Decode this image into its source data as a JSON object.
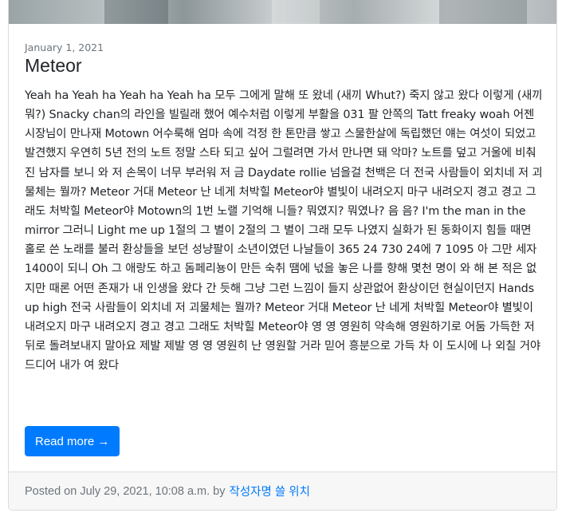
{
  "post": {
    "date": "January 1, 2021",
    "title": "Meteor",
    "body": "Yeah ha Yeah ha Yeah ha Yeah ha 모두 그에게 말해 또 왔네 (새끼 Whut?) 죽지 않고 왔다 이렇게 (새끼 뭐?) Snacky chan의 라인을 빌릴래 했어 예수처럼 이렇게 부활을 031 팔 안쪽의 Tatt freaky woah 어젠 시장님이 만나재 Motown 어수룩해 엄마 속에 걱정 한 톤만큼 쌓고 스물한살에 독립했던 얘는 여섯이 되었고 발견했지 우연히 5년 전의 노트 정말 스타 되고 싶어 그럴려면 가서 만나면 돼 악마? 노트를 덮고 거울에 비춰진 남자를 보니 와 저 손목이 너무 부러워 저 금 Daydate rollie 넘을걸 천백은 더 전국 사람들이 외치네 저 괴물체는 뭘까? Meteor 거대 Meteor 난 네게 처박힐 Meteor야 별빛이 내려오지 마구 내려오지 경고 경고 그래도 처박힐 Meteor야 Motown의 1번 노랠 기억해 니들? 뭐였지? 뭐였나? 음 음? I'm the man in the mirror 그러니 Light me up 1절의 그 별이 2절의 그 별이 그래 모두 나였지 실화가 된 동화이지 힘들 때면 홀로 쓴 노래를 불러 환상들을 보던 성냥팔이 소년이였던 나날들이 365 24 730 24에 7 1095 아 그만 세자 1400이 되니 Oh 그 애랑도 하고 돔페리뇽이 만든 숙취 땜에 넋을 놓은 나를 향해 몇천 명이 와 해 본 적은 없지만 때론 어떤 존재가 내 인생을 왔다 간 듯해 그냥 그런 느낌이 들지 상관없어 환상이던 현실이던지 Hands up high 전국 사람들이 외치네 저 괴물체는 뭘까? Meteor 거대 Meteor 난 네게 처박힐 Meteor야 별빛이 내려오지 마구 내려오지 경고 경고 그래도 처박힐 Meteor야 영 영 영원히 약속해 영원하기로 어둠 가득한 저 뒤로 돌려보내지 말아요 제발 제발 영 영 영원히 난 영원할 거라 믿어 흥분으로 가득 차 이 도시에 나 외칠 거야 드디어 내가 여 왔다",
    "read_more_label": "Read more →"
  },
  "footer": {
    "posted_on": "Posted on July 29, 2021, 10:08 a.m. by",
    "author": "작성자명 쓸 위치"
  },
  "colors": {
    "accent": "#007bff",
    "footer_bg": "#f7f7f7",
    "muted_text": "#6c757d"
  }
}
